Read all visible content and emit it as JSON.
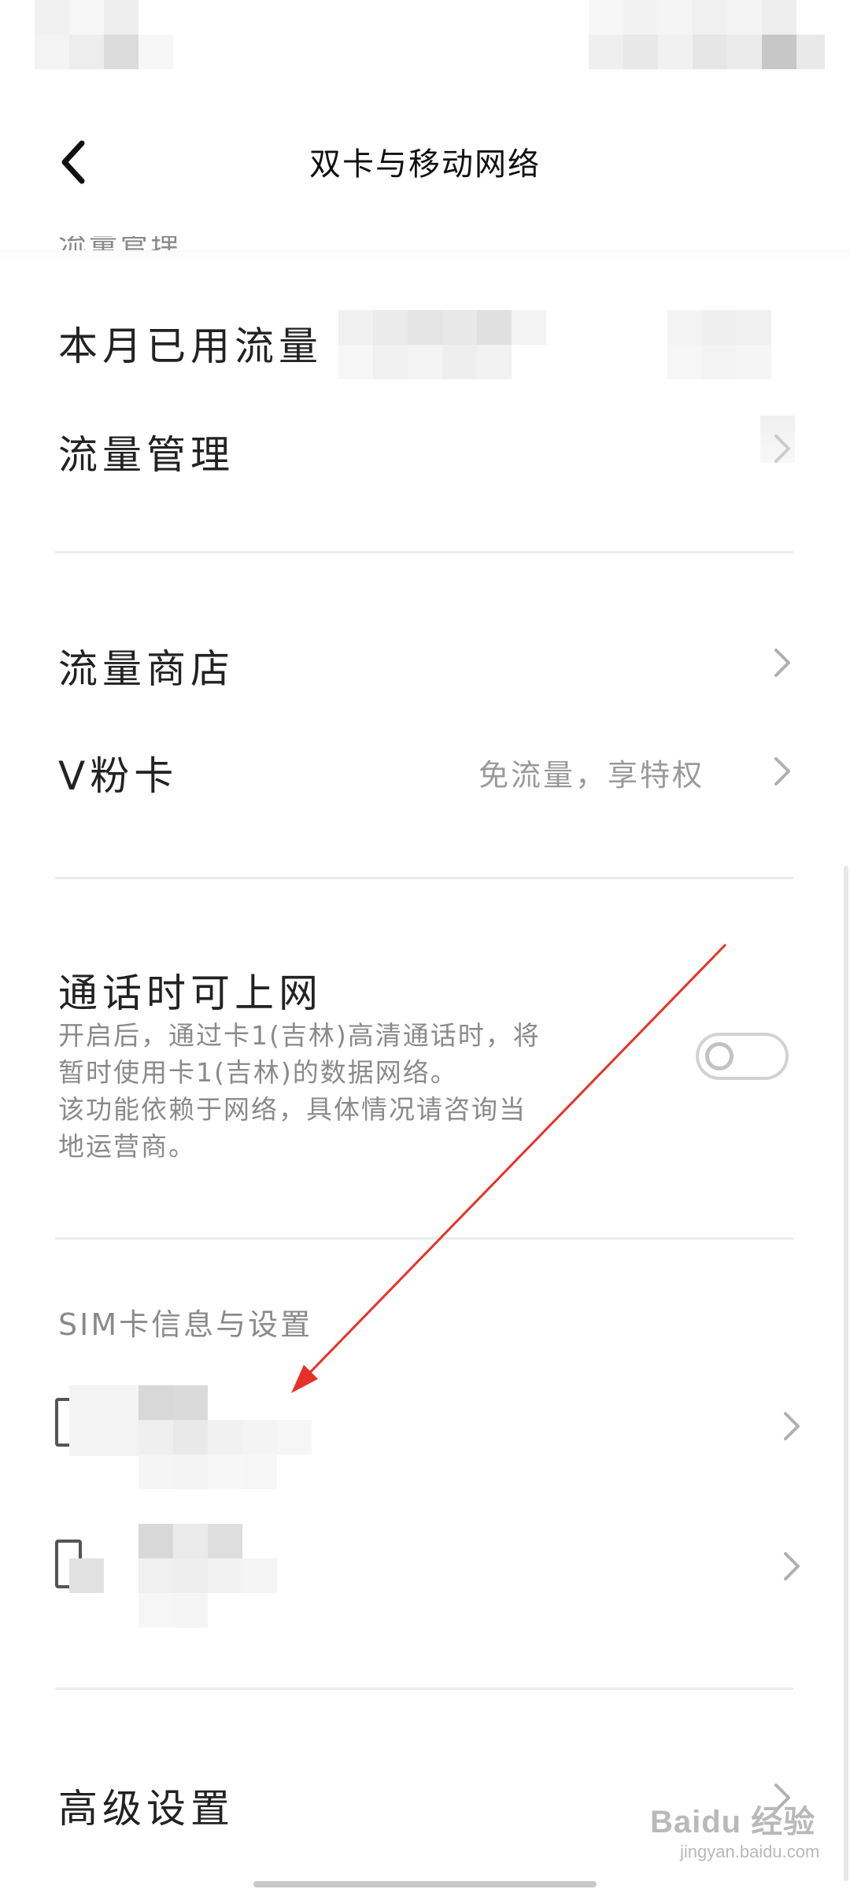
{
  "header": {
    "title": "双卡与移动网络"
  },
  "usage": {
    "section_title_partial": "流量管理",
    "used_this_month_label": "本月已用流量",
    "manage_label": "流量管理"
  },
  "store": {
    "store_label": "流量商店",
    "vcard_label": "V粉卡",
    "vcard_value": "免流量，享特权"
  },
  "call_data": {
    "label": "通话时可上网",
    "desc_lines": [
      "开启后，通过卡1(吉林)高清通话时，将",
      "暂时使用卡1(吉林)的数据网络。",
      "该功能依赖于网络，具体情况请咨询当",
      "地运营商。"
    ],
    "toggle_on": false
  },
  "sim": {
    "section_title": "SIM卡信息与设置"
  },
  "advanced": {
    "label": "高级设置"
  },
  "watermark": {
    "brand": "Baidu 经验",
    "url": "jingyan.baidu.com"
  },
  "colors": {
    "annotation_arrow": "#e8302a",
    "divider": "#ececec",
    "secondary_text": "#9a9a9a"
  },
  "icons": [
    "back-arrow-icon",
    "chevron-right-icon",
    "sim-card-icon",
    "annotation-arrow"
  ]
}
